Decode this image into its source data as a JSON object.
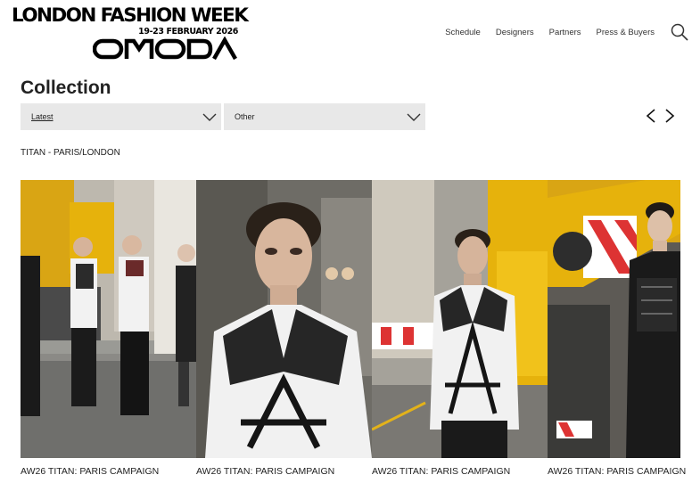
{
  "brand": {
    "line1": "LONDON FASHION WEEK",
    "dates": "19-23 FEBRUARY 2026",
    "sponsor": "OMODA"
  },
  "nav": {
    "items": [
      "Schedule",
      "Designers",
      "Partners",
      "Press & Buyers"
    ],
    "search_icon": "search-icon"
  },
  "page": {
    "title": "Collection"
  },
  "filters": {
    "first": {
      "value": "Latest"
    },
    "second": {
      "value": "Other"
    }
  },
  "carousel": {
    "prev_icon": "chevron-left-icon",
    "next_icon": "chevron-right-icon"
  },
  "collection": {
    "name": "TITAN - PARIS/LONDON",
    "images": [
      {
        "caption": "AW26 TITAN: PARIS CAMPAIGN"
      },
      {
        "caption": "AW26 TITAN: PARIS CAMPAIGN"
      },
      {
        "caption": "AW26 TITAN: PARIS CAMPAIGN"
      },
      {
        "caption": "AW26 TITAN: PARIS CAMPAIGN"
      }
    ]
  },
  "colors": {
    "dropdown_bg": "#e8e8e8",
    "text": "#222222",
    "crane_yellow": "#e6b20c"
  }
}
